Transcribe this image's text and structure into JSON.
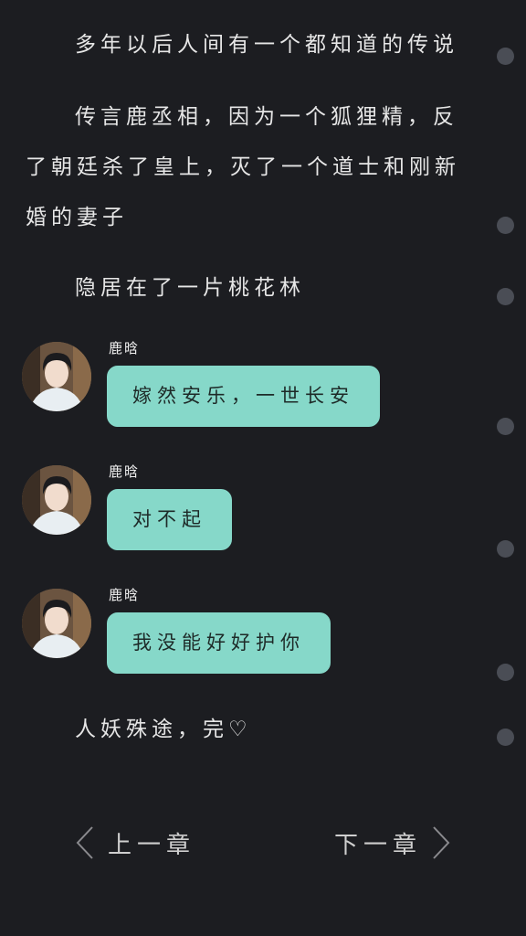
{
  "story": {
    "paragraphs": [
      "多年以后人间有一个都知道的传说",
      "传言鹿丞相，因为一个狐狸精，反了朝廷杀了皇上，灭了一个道士和刚新婚的妻子",
      "隐居在了一片桃花林",
      "人妖殊途，完♡"
    ]
  },
  "messages": [
    {
      "sender": "鹿晗",
      "text": "嫁然安乐，一世长安"
    },
    {
      "sender": "鹿晗",
      "text": "对不起"
    },
    {
      "sender": "鹿晗",
      "text": "我没能好好护你"
    }
  ],
  "nav": {
    "prev_label": "上一章",
    "next_label": "下一章"
  },
  "colors": {
    "background": "#1c1d21",
    "bubble": "#86d8c9",
    "scroll_dot": "#4a4d55"
  },
  "icons": {
    "prev": "chevron-left-icon",
    "next": "chevron-right-icon"
  }
}
